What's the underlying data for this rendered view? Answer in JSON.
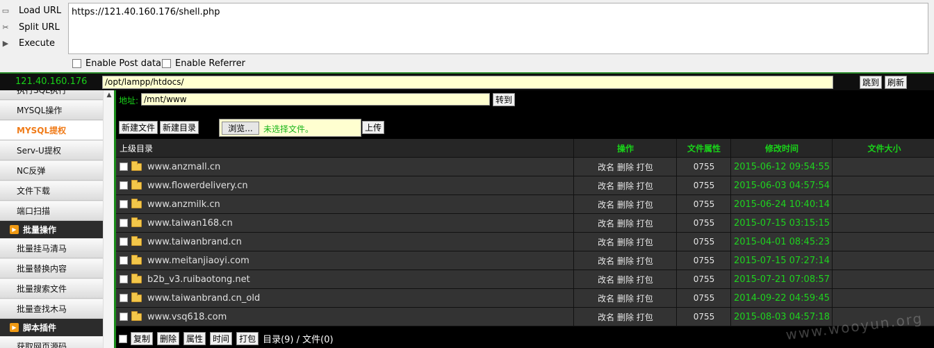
{
  "hackbar": {
    "buttons": [
      {
        "label": "Load URL",
        "icon": "load-url-icon"
      },
      {
        "label": "Split URL",
        "icon": "scissors-icon"
      },
      {
        "label": "Execute",
        "icon": "play-icon"
      }
    ],
    "url": "https://121.40.160.176/shell.php",
    "options": [
      "Enable Post data",
      "Enable Referrer"
    ]
  },
  "topbar": {
    "ip": "121.40.160.176",
    "path": "/opt/lampp/htdocs/",
    "jump_label": "跳到",
    "refresh_label": "刷新"
  },
  "sidebar": {
    "items": [
      {
        "label": "执行SQL执行",
        "type": "item"
      },
      {
        "label": "MYSQL操作",
        "type": "item"
      },
      {
        "label": "MYSQL提权",
        "type": "active"
      },
      {
        "label": "Serv-U提权",
        "type": "item"
      },
      {
        "label": "NC反弹",
        "type": "item"
      },
      {
        "label": "文件下载",
        "type": "item"
      },
      {
        "label": "端口扫描",
        "type": "item"
      },
      {
        "label": "批量操作",
        "type": "header"
      },
      {
        "label": "批量挂马清马",
        "type": "item"
      },
      {
        "label": "批量替换内容",
        "type": "item"
      },
      {
        "label": "批量搜索文件",
        "type": "item"
      },
      {
        "label": "批量查找木马",
        "type": "item"
      },
      {
        "label": "脚本插件",
        "type": "header"
      },
      {
        "label": "获取网页源码",
        "type": "item"
      }
    ]
  },
  "main": {
    "address_label": "地址:",
    "address_value": "/mnt/www",
    "goto_label": "转到",
    "new_file_label": "新建文件",
    "new_dir_label": "新建目录",
    "browse_label": "浏览...",
    "no_file_label": "未选择文件。",
    "upload_label": "上传",
    "table": {
      "headers": {
        "name": "上级目录",
        "op": "操作",
        "attr": "文件属性",
        "time": "修改时间",
        "size": "文件大小"
      },
      "rows": [
        {
          "name": "www.anzmall.cn",
          "ops": "改名 删除 打包",
          "attr": "0755",
          "time": "2015-06-12 09:54:55"
        },
        {
          "name": "www.flowerdelivery.cn",
          "ops": "改名 删除 打包",
          "attr": "0755",
          "time": "2015-06-03 04:57:54"
        },
        {
          "name": "www.anzmilk.cn",
          "ops": "改名 删除 打包",
          "attr": "0755",
          "time": "2015-06-24 10:40:14"
        },
        {
          "name": "www.taiwan168.cn",
          "ops": "改名 删除 打包",
          "attr": "0755",
          "time": "2015-07-15 03:15:15"
        },
        {
          "name": "www.taiwanbrand.cn",
          "ops": "改名 删除 打包",
          "attr": "0755",
          "time": "2015-04-01 08:45:23"
        },
        {
          "name": "www.meitanjiaoyi.com",
          "ops": "改名 删除 打包",
          "attr": "0755",
          "time": "2015-07-15 07:27:14"
        },
        {
          "name": "b2b_v3.ruibaotong.net",
          "ops": "改名 删除 打包",
          "attr": "0755",
          "time": "2015-07-21 07:08:57"
        },
        {
          "name": "www.taiwanbrand.cn_old",
          "ops": "改名 删除 打包",
          "attr": "0755",
          "time": "2014-09-22 04:59:45"
        },
        {
          "name": "www.vsq618.com",
          "ops": "改名 删除 打包",
          "attr": "0755",
          "time": "2015-08-03 04:57:18"
        }
      ]
    },
    "bottom": {
      "buttons": [
        "复制",
        "删除",
        "属性",
        "时间",
        "打包"
      ],
      "summary": "目录(9) / 文件(0)"
    }
  },
  "watermark": "www.wooyun.org"
}
